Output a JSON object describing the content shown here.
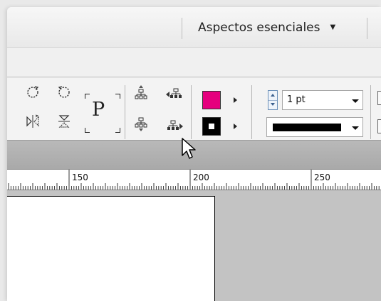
{
  "header": {
    "workspace_label": "Aspectos esenciales"
  },
  "control_panel": {
    "fill_swatch": {
      "color": "#e6007e"
    },
    "stroke_swatch": {
      "color": "#000000"
    },
    "stroke_weight": {
      "value": "1 pt"
    },
    "stroke_type": {
      "value": "solid"
    },
    "paragraph_glyph": "P"
  },
  "ruler": {
    "labels": [
      "150",
      "200",
      "250"
    ]
  },
  "colors": {
    "accent_fill": "#e6007e",
    "pasteboard": "#c3c3c3"
  }
}
